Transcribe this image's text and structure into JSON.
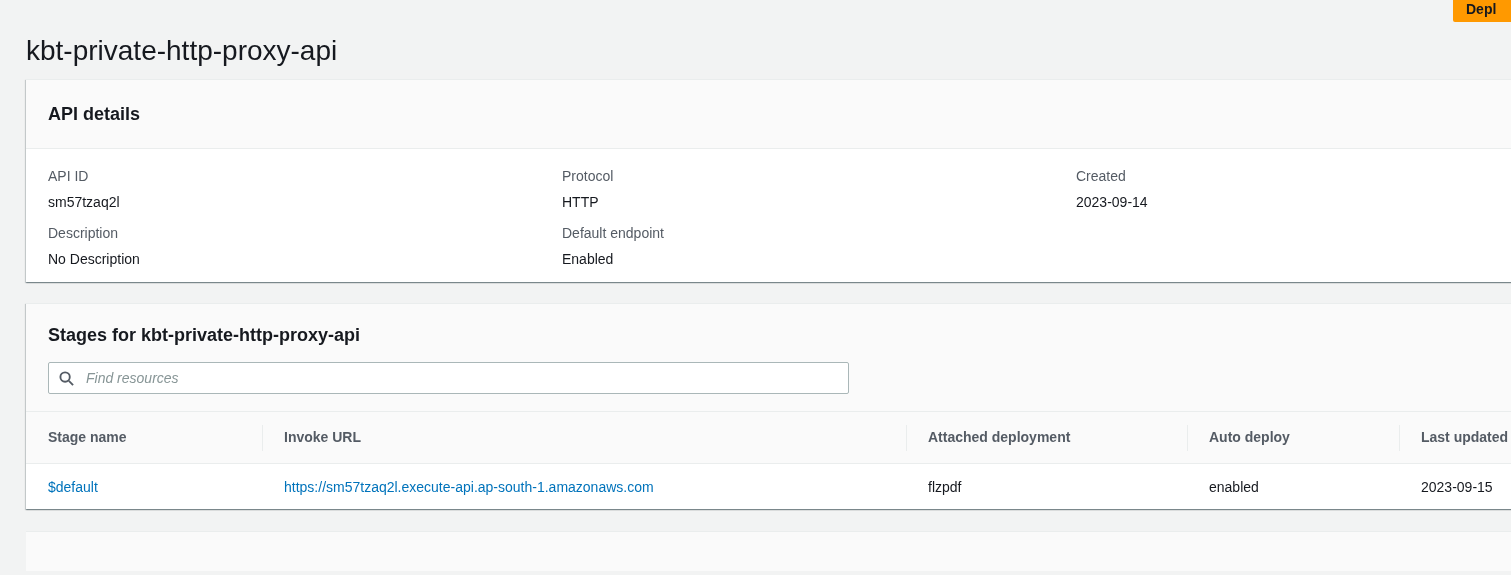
{
  "deploy_button": {
    "label": "Depl"
  },
  "title": "kbt-private-http-proxy-api",
  "api_details": {
    "heading": "API details",
    "fields": [
      {
        "label": "API ID",
        "value": "sm57tzaq2l"
      },
      {
        "label": "Protocol",
        "value": "HTTP"
      },
      {
        "label": "Created",
        "value": "2023-09-14"
      },
      {
        "label": "Description",
        "value": "No Description"
      },
      {
        "label": "Default endpoint",
        "value": "Enabled"
      }
    ]
  },
  "stages": {
    "heading": "Stages for kbt-private-http-proxy-api",
    "search": {
      "placeholder": "Find resources"
    },
    "columns": [
      "Stage name",
      "Invoke URL",
      "Attached deployment",
      "Auto deploy",
      "Last updated"
    ],
    "rows": [
      {
        "cells": [
          {
            "text": "$default",
            "kind": "link"
          },
          {
            "text": "https://sm57tzaq2l.execute-api.ap-south-1.amazonaws.com",
            "kind": "link"
          },
          {
            "text": "flzpdf",
            "kind": "text"
          },
          {
            "text": "enabled",
            "kind": "text"
          },
          {
            "text": "2023-09-15",
            "kind": "text"
          }
        ]
      }
    ]
  }
}
